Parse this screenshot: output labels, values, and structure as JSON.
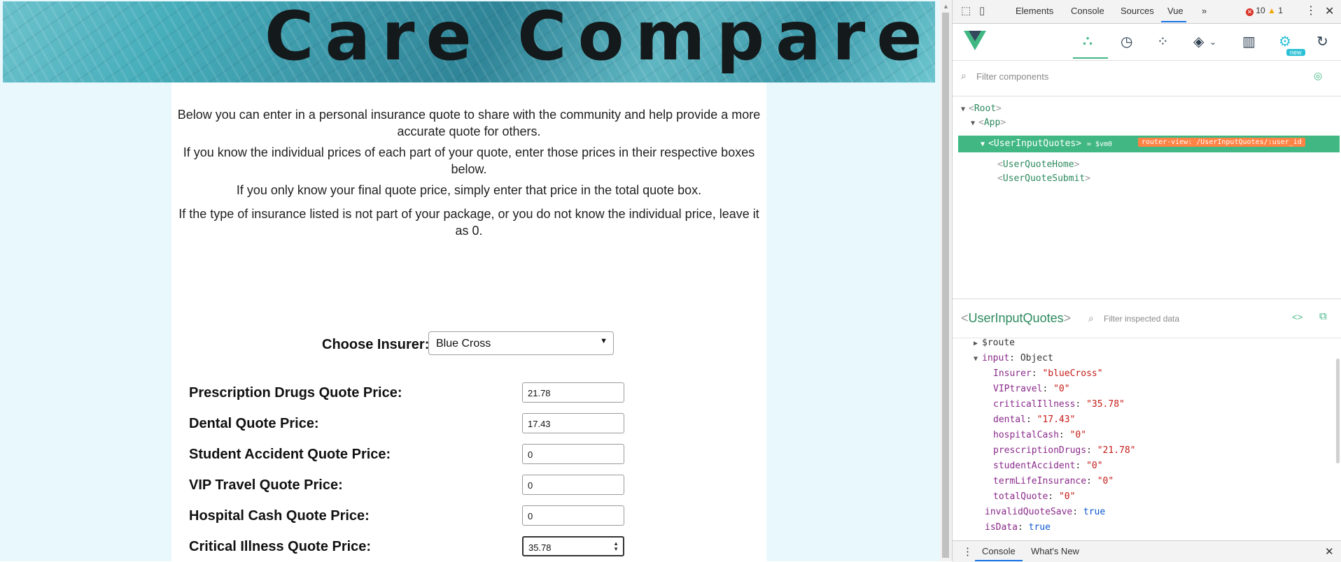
{
  "page": {
    "banner_title": "Care Compare SK",
    "intro_paragraphs": [
      [
        "Below you can enter in a personal insurance quote to share with the community and help provide a more",
        "accurate quote for others."
      ],
      [
        "If you know the individual prices of each part of your quote, enter those prices in their respective boxes",
        "below."
      ],
      [
        "If you only know your final quote price, simply enter that price in the total quote box."
      ],
      [
        "If the type of insurance listed is not part of your package, or you do not know the individual price, leave it",
        "as 0."
      ]
    ],
    "insurer_label": "Choose Insurer:",
    "insurer_selected": "Blue Cross",
    "quote_rows": [
      {
        "label": "Prescription Drugs Quote Price:",
        "value": "21.78"
      },
      {
        "label": "Dental Quote Price:",
        "value": "17.43"
      },
      {
        "label": "Student Accident Quote Price:",
        "value": "0"
      },
      {
        "label": "VIP Travel Quote Price:",
        "value": "0"
      },
      {
        "label": "Hospital Cash Quote Price:",
        "value": "0"
      },
      {
        "label": "Critical Illness Quote Price:",
        "value": "35.78"
      }
    ]
  },
  "devtools": {
    "tabs": [
      "Elements",
      "Console",
      "Sources",
      "Vue"
    ],
    "more": "»",
    "errors": "10",
    "warnings": "1",
    "vue_new_badge": "new",
    "filter_components_placeholder": "Filter components",
    "tree": {
      "root": "Root",
      "app": "App",
      "selected": "UserInputQuotes",
      "selected_suffix": "= $vm0",
      "router_chip": "router-view: /UserInputQuotes/:user_id",
      "children": [
        "UserQuoteHome",
        "UserQuoteSubmit"
      ]
    },
    "inspector_title": "UserInputQuotes",
    "inspector_filter_placeholder": "Filter inspected data",
    "state": {
      "route": "$route",
      "input_key": "input",
      "input_type": "Object",
      "input_fields": [
        {
          "key": "Insurer",
          "value": "\"blueCross\""
        },
        {
          "key": "VIPtravel",
          "value": "\"0\""
        },
        {
          "key": "criticalIllness",
          "value": "\"35.78\""
        },
        {
          "key": "dental",
          "value": "\"17.43\""
        },
        {
          "key": "hospitalCash",
          "value": "\"0\""
        },
        {
          "key": "prescriptionDrugs",
          "value": "\"21.78\""
        },
        {
          "key": "studentAccident",
          "value": "\"0\""
        },
        {
          "key": "termLifeInsurance",
          "value": "\"0\""
        },
        {
          "key": "totalQuote",
          "value": "\"0\""
        }
      ],
      "invalid_key": "invalidQuoteSave",
      "invalid_value": "true",
      "isdata_key": "isData",
      "isdata_value": "true"
    },
    "drawer_tabs": [
      "Console",
      "What's New"
    ]
  }
}
